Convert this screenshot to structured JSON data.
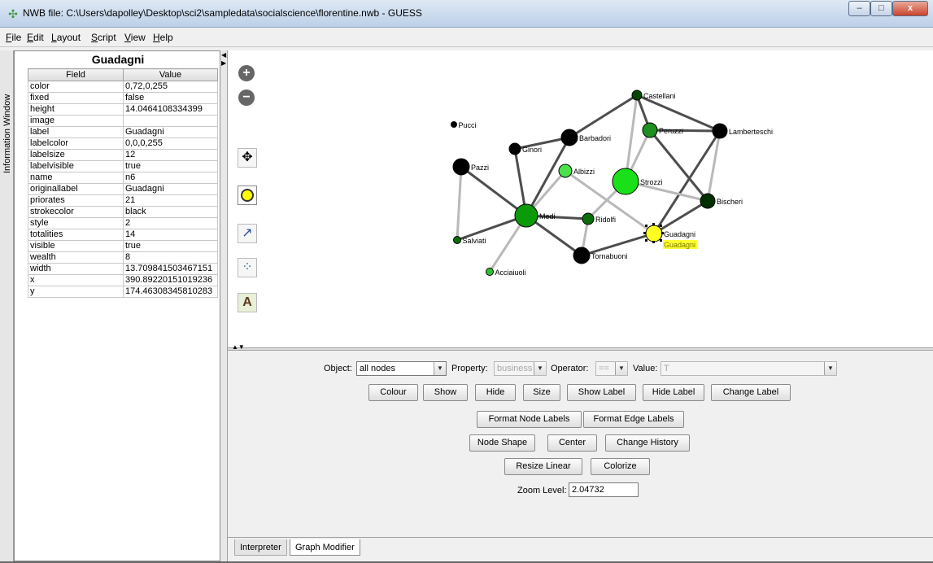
{
  "window": {
    "title": "NWB file: C:\\Users\\dapolley\\Desktop\\sci2\\sampledata\\socialscience\\florentine.nwb - GUESS",
    "app_icon": "guess-app-icon",
    "controls": {
      "minimize": "–",
      "maximize": "□",
      "close": "x"
    }
  },
  "menu": [
    {
      "label": "File",
      "u": "F",
      "rest": "ile"
    },
    {
      "label": "Edit",
      "u": "E",
      "rest": "dit"
    },
    {
      "label": "Layout",
      "u": "L",
      "rest": "ayout"
    },
    {
      "label": "Script",
      "u": "S",
      "rest": "cript"
    },
    {
      "label": "View",
      "u": "V",
      "rest": "iew"
    },
    {
      "label": "Help",
      "u": "H",
      "rest": "elp"
    }
  ],
  "side_tab": {
    "label": "Information Window"
  },
  "info_panel": {
    "title": "Guadagni",
    "headers": {
      "field": "Field",
      "value": "Value"
    },
    "rows": [
      {
        "field": "color",
        "value": "0,72,0,255"
      },
      {
        "field": "fixed",
        "value": "false"
      },
      {
        "field": "height",
        "value": "14.0464108334399"
      },
      {
        "field": "image",
        "value": ""
      },
      {
        "field": "label",
        "value": "Guadagni"
      },
      {
        "field": "labelcolor",
        "value": "0,0,0,255"
      },
      {
        "field": "labelsize",
        "value": "12"
      },
      {
        "field": "labelvisible",
        "value": "true"
      },
      {
        "field": "name",
        "value": "n6"
      },
      {
        "field": "originallabel",
        "value": "Guadagni"
      },
      {
        "field": "priorates",
        "value": "21"
      },
      {
        "field": "strokecolor",
        "value": "black"
      },
      {
        "field": "style",
        "value": "2"
      },
      {
        "field": "totalities",
        "value": "14"
      },
      {
        "field": "visible",
        "value": "true"
      },
      {
        "field": "wealth",
        "value": "8"
      },
      {
        "field": "width",
        "value": "13.709841503467151"
      },
      {
        "field": "x",
        "value": "390.89220151019236"
      },
      {
        "field": "y",
        "value": "174.46308345810283"
      }
    ]
  },
  "toolbar_icons": [
    "zoom-in-icon",
    "zoom-out-icon",
    "move-icon",
    "select-node-icon",
    "edge-select-icon",
    "drag-select-icon",
    "text-icon"
  ],
  "graph": {
    "nodes": [
      {
        "label": "Pucci",
        "color": "#000000"
      },
      {
        "label": "Castellani",
        "color": "#004800"
      },
      {
        "label": "Peruzzi",
        "color": "#1f8f1f"
      },
      {
        "label": "Lamberteschi",
        "color": "#000000"
      },
      {
        "label": "Barbadori",
        "color": "#000000"
      },
      {
        "label": "Ginori",
        "color": "#000000"
      },
      {
        "label": "Albizzi",
        "color": "#4de04d"
      },
      {
        "label": "Strozzi",
        "color": "#1ae01a"
      },
      {
        "label": "Pazzi",
        "color": "#000000"
      },
      {
        "label": "Bischeri",
        "color": "#003000"
      },
      {
        "label": "Medi",
        "color": "#0a9a0a"
      },
      {
        "label": "Ridolfi",
        "color": "#0b6e0b"
      },
      {
        "label": "Guadagni",
        "color": "#ffff22"
      },
      {
        "label": "Salviati",
        "color": "#0b6e0b"
      },
      {
        "label": "Tornabuoni",
        "color": "#000000"
      },
      {
        "label": "Acciaiuoli",
        "color": "#2fc02f"
      }
    ],
    "selected_label": "Guadagni",
    "selected_label_bg": "#ffff33",
    "edge_dark": "#4d4d4d",
    "edge_light": "#b9b9b9"
  },
  "graph_modifier": {
    "object_label": "Object:",
    "object_value": "all nodes",
    "property_label": "Property:",
    "property_value": "business",
    "operator_label": "Operator:",
    "operator_value": "==",
    "value_label": "Value:",
    "value_value": "T",
    "buttons_row1": [
      "Colour",
      "Show",
      "Hide",
      "Size",
      "Show Label",
      "Hide Label",
      "Change Label"
    ],
    "buttons_row2": [
      "Format Node Labels",
      "Format Edge Labels"
    ],
    "buttons_row3": [
      "Node Shape",
      "Center",
      "Change History"
    ],
    "buttons_row4": [
      "Resize Linear",
      "Colorize"
    ],
    "zoom_label": "Zoom Level:",
    "zoom_value": "2.04732"
  },
  "bottom_tabs": [
    {
      "label": "Interpreter",
      "active": false
    },
    {
      "label": "Graph Modifier",
      "active": true
    }
  ]
}
